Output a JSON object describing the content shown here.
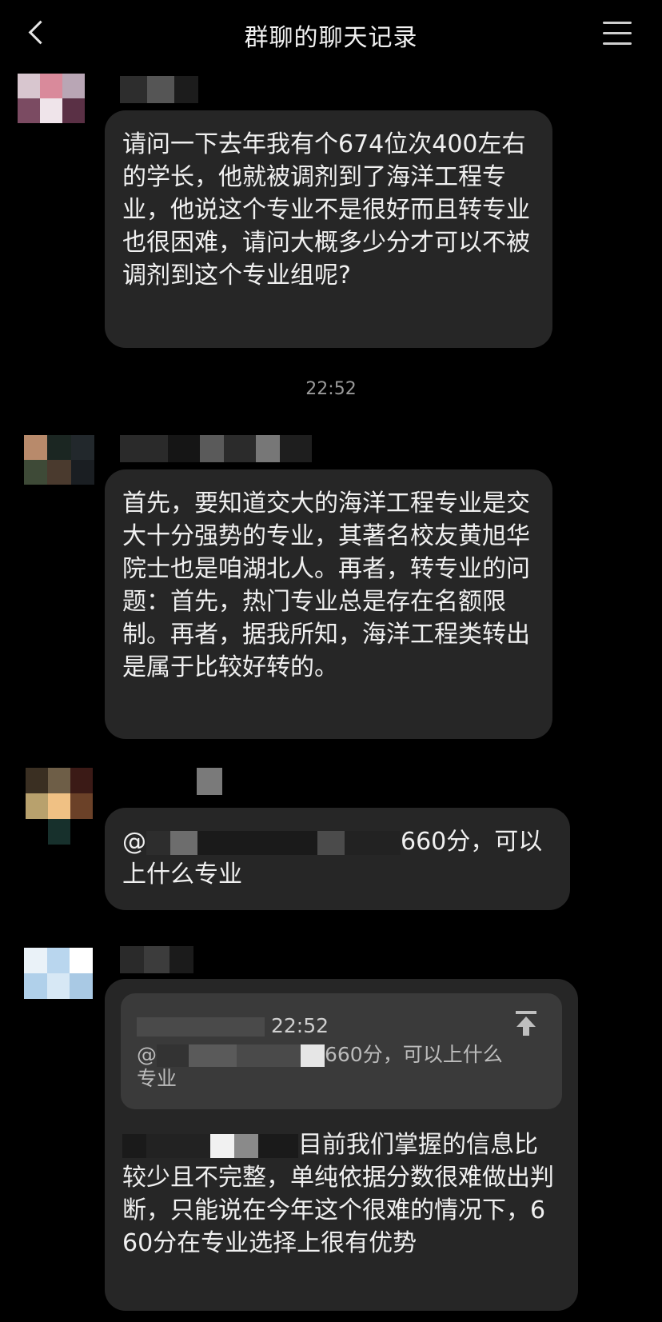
{
  "header": {
    "title": "群聊的聊天记录"
  },
  "messages": [
    {
      "text": "请问一下去年我有个674位次400左右的学长，他就被调剂到了海洋工程专业，他说这个专业不是很好而且转专业也很困难，请问大概多少分才可以不被调剂到这个专业组呢?"
    },
    {
      "text": "首先，要知道交大的海洋工程专业是交大十分强势的专业，其著名校友黄旭华院士也是咱湖北人。再者，转专业的问题：首先，热门专业总是存在名额限制。再者，据我所知，海洋工程类转出是属于比较好转的。"
    },
    {
      "text_prefix": "@",
      "text_suffix": "660分，可以上什么专业"
    },
    {
      "quote_time": "22:52",
      "quote_prefix": "@",
      "quote_suffix": "660分，可以上什么专业",
      "text_suffix": "目前我们掌握的信息比较少且不完整，单纯依据分数很难做出判断，只能说在今年这个很难的情况下，660分在专业选择上很有优势"
    }
  ],
  "timestamp": "22:52",
  "icons": {
    "back": "chevron-left-icon",
    "menu": "menu-icon",
    "pin": "pin-top-icon"
  }
}
